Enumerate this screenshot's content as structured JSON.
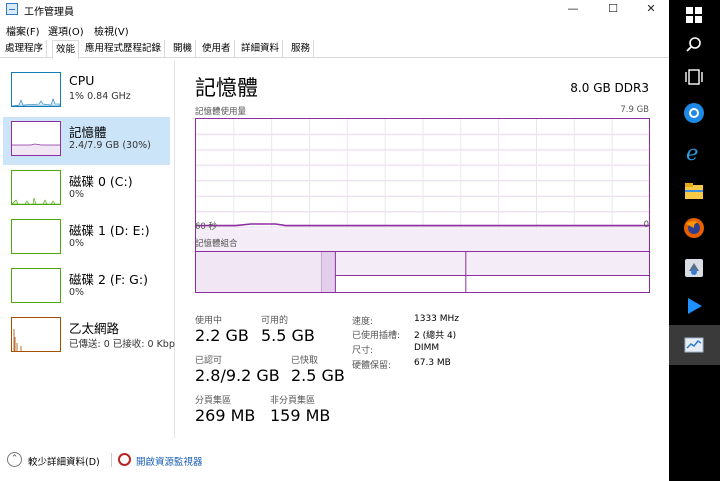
{
  "window": {
    "title": "工作管理員",
    "controls": {
      "minimize": "—",
      "maximize": "☐",
      "close": "✕"
    }
  },
  "menu": [
    "檔案(F)",
    "選項(O)",
    "檢視(V)"
  ],
  "tabs": [
    "處理程序",
    "效能",
    "應用程式歷程記錄",
    "開機",
    "使用者",
    "詳細資料",
    "服務"
  ],
  "active_tab": "效能",
  "sidebar": {
    "items": [
      {
        "name": "CPU",
        "value": "1% 0.84 GHz",
        "color": "#117dbb"
      },
      {
        "name": "記憶體",
        "value": "2.4/7.9 GB (30%)",
        "color": "#8b2fa0"
      },
      {
        "name": "磁碟 0 (C:)",
        "value": "0%",
        "color": "#4da60c"
      },
      {
        "name": "磁碟 1 (D: E:)",
        "value": "0%",
        "color": "#4da60c"
      },
      {
        "name": "磁碟 2 (F: G:)",
        "value": "0%",
        "color": "#4da60c"
      },
      {
        "name": "乙太網路",
        "value": "已傳送: 0 已接收: 0 Kbp",
        "color": "#a74f01"
      }
    ],
    "selected": "記憶體"
  },
  "main": {
    "title": "記憶體",
    "spec": "8.0 GB DDR3",
    "usage_label": "記憶體使用量",
    "usage_max": "7.9 GB",
    "time_left": "60 秒",
    "time_right": "0",
    "composition_label": "記憶體組合",
    "usage_level": 0.3,
    "stats": {
      "in_use_label": "使用中",
      "in_use": "2.2 GB",
      "available_label": "可用的",
      "available": "5.5 GB",
      "committed_label": "已認可",
      "committed": "2.8/9.2 GB",
      "cached_label": "已快取",
      "cached": "2.5 GB",
      "paged_label": "分頁集區",
      "paged": "269 MB",
      "nonpaged_label": "非分頁集區",
      "nonpaged": "159 MB"
    },
    "info": [
      {
        "k": "速度:",
        "v": "1333 MHz"
      },
      {
        "k": "已使用插槽:",
        "v": "2 (總共 4)"
      },
      {
        "k": "尺寸:",
        "v": "DIMM"
      },
      {
        "k": "硬體保留:",
        "v": "67.3 MB"
      }
    ]
  },
  "footer": {
    "fewer_details": "較少詳細資料(D)",
    "open_resmon": "開啟資源監視器"
  },
  "colors": {
    "memory": "#8b2fa0",
    "selection": "#cce4f7",
    "link": "#1a5fb4"
  },
  "taskbar": [
    "windows-logo-icon",
    "search-icon",
    "task-view-icon",
    "app-icon",
    "internet-explorer-icon",
    "file-explorer-icon",
    "firefox-icon",
    "app-icon",
    "media-player-icon",
    "task-manager-icon"
  ]
}
